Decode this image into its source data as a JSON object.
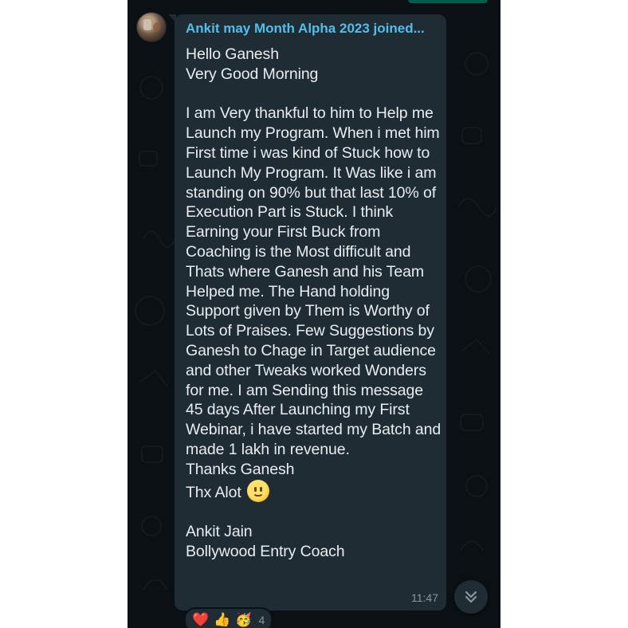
{
  "sender": "Ankit may Month Alpha 2023 joined...",
  "message": {
    "body": "Hello Ganesh\nVery Good Morning\n\nI am Very thankful to him to Help me Launch my Program. When i met him First time i was kind of Stuck how to Launch My Program. It Was like i am standing on 90% but that last 10% of Execution Part is Stuck. I think Earning your First Buck from Coaching is the Most difficult and Thats where Ganesh and his Team Helped me. The Hand holding Support given by Them is Worthy of Lots of Praises. Few Suggestions by Ganesh to Chage in Target audience and other Tweaks worked Wonders for me. I am Sending this message 45 days After Launching my First Webinar, i have started my Batch and made 1 lakh in revenue.\nThanks Ganesh\n",
    "closing": "Thx Alot",
    "signature": "\n\nAnkit Jain\nBollywood Entry Coach",
    "time": "11:47"
  },
  "reactions": {
    "emojis": [
      "❤️",
      "👍",
      "🥳"
    ],
    "count": "4"
  },
  "icons": {
    "avatar": "sender-avatar",
    "scroll": "double-chevron-down-icon",
    "smile": "smiling-face-emoji-icon"
  },
  "colors": {
    "background": "#0b1014",
    "bubble": "#1f2c34",
    "sender": "#53bdeb",
    "text": "#e9edef",
    "meta": "#8696a0"
  }
}
